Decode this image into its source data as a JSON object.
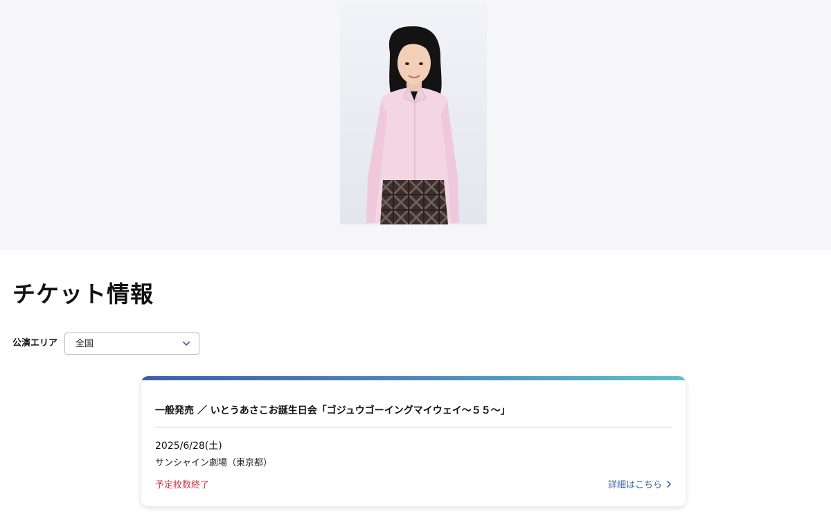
{
  "hero": {
    "photo_icon": "portrait-photo"
  },
  "tickets": {
    "title": "チケット情報",
    "area_filter": {
      "label": "公演エリア",
      "selected": "全国",
      "icon": "chevron-down-icon"
    },
    "events": [
      {
        "title": "一般発売 ／ いとうあさこお誕生日会「ゴジュウゴーイングマイウェイ〜５５〜」",
        "date": "2025/6/28(土)",
        "venue": "サンシャイン劇場（東京都）",
        "status": "予定枚数終了",
        "link_label": "詳細はこちら",
        "link_icon": "chevron-right-icon"
      }
    ]
  },
  "colors": {
    "accent_blue": "#3f64a8",
    "status_red": "#d0354d",
    "gradient_start": "#3e5dab",
    "gradient_end": "#5cc1c3",
    "hero_bg": "#f6f6f8"
  }
}
